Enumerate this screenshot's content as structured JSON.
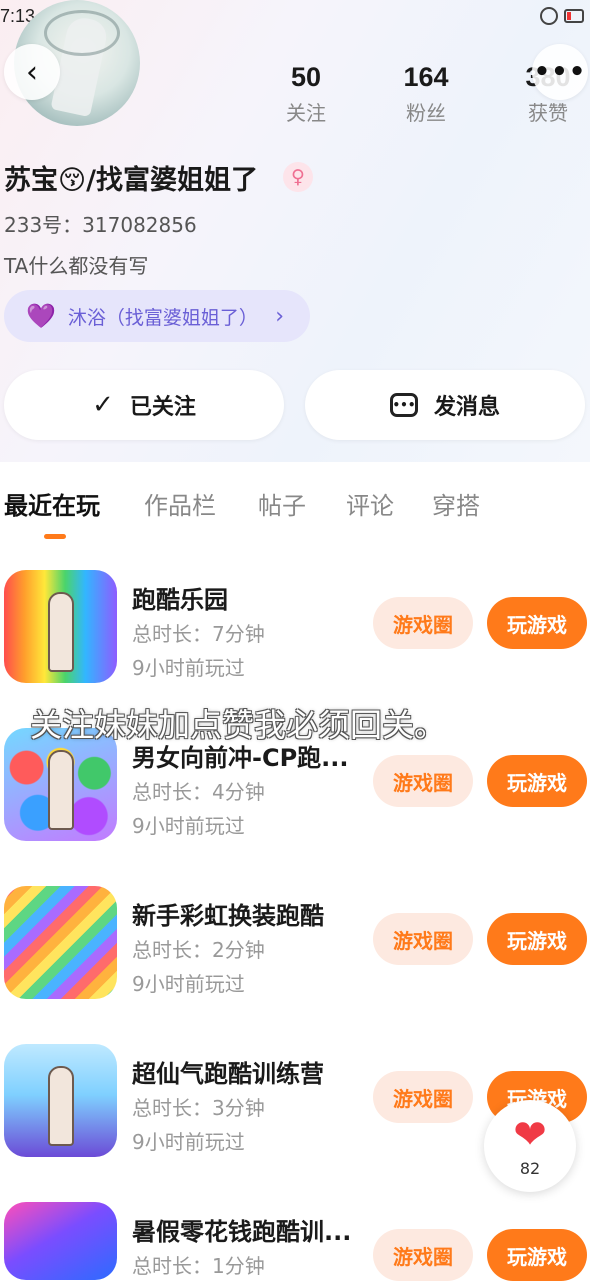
{
  "status_bar": {
    "time": "7:13"
  },
  "nav": {
    "back_icon": "‹",
    "more_icon": "•••"
  },
  "stats": [
    {
      "value": "50",
      "label": "关注"
    },
    {
      "value": "164",
      "label": "粉丝"
    },
    {
      "value": "380",
      "label": "获赞"
    }
  ],
  "profile": {
    "username": "苏宝😚/找富婆姐姐了",
    "gender_icon": "♀",
    "user_id": "233号：317082856",
    "bio": "TA什么都没有写",
    "guild_label": "沐浴（找富婆姐姐了）",
    "guild_icon": "💜",
    "guild_arrow": "›"
  },
  "actions": {
    "follow_label": "已关注",
    "follow_icon": "✓",
    "message_label": "发消息"
  },
  "tabs": [
    {
      "label": "最近在玩",
      "active": true
    },
    {
      "label": "作品栏"
    },
    {
      "label": "帖子"
    },
    {
      "label": "评论"
    },
    {
      "label": "穿搭"
    }
  ],
  "games": [
    {
      "title": "跑酷乐园",
      "duration": "总时长：7分钟",
      "last_played": "9小时前玩过",
      "circle_label": "游戏圈",
      "play_label": "玩游戏"
    },
    {
      "title": "男女向前冲-CP跑...",
      "duration": "总时长：4分钟",
      "last_played": "9小时前玩过",
      "circle_label": "游戏圈",
      "play_label": "玩游戏"
    },
    {
      "title": "新手彩虹换装跑酷",
      "duration": "总时长：2分钟",
      "last_played": "9小时前玩过",
      "circle_label": "游戏圈",
      "play_label": "玩游戏"
    },
    {
      "title": "超仙气跑酷训练营",
      "duration": "总时长：3分钟",
      "last_played": "9小时前玩过",
      "circle_label": "游戏圈",
      "play_label": "玩游戏"
    },
    {
      "title": "暑假零花钱跑酷训...",
      "duration": "总时长：1分钟",
      "last_played": "",
      "circle_label": "游戏圈",
      "play_label": "玩游戏"
    }
  ],
  "overlay_caption": "关注妹妹加点赞我必须回关。",
  "like": {
    "icon": "❤",
    "count": "82"
  },
  "colors": {
    "accent": "#ff7a1a",
    "accent_light": "#fde9e0",
    "guild": "#6a5fd6"
  }
}
